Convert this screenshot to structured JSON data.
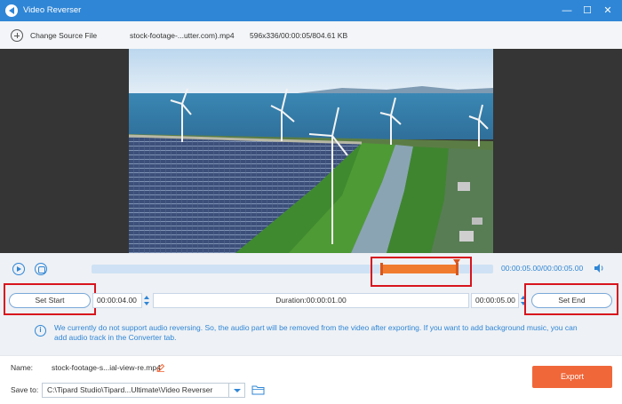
{
  "window": {
    "title": "Video Reverser",
    "minimize_glyph": "—",
    "maximize_glyph": "☐",
    "close_glyph": "✕"
  },
  "infobar": {
    "change_source_label": "Change Source File",
    "filename": "stock-footage-...utter.com).mp4",
    "file_info": "596x336/00:00:05/804.61 KB"
  },
  "player": {
    "current_time": "00:00:05.00",
    "total_time": "/00:00:05.00",
    "trim_start_fraction": 0.72,
    "trim_end_fraction": 0.91
  },
  "trim": {
    "set_start_label": "Set Start",
    "start_value": "00:00:04.00",
    "duration_text": "Duration:00:00:01.00",
    "end_value": "00:00:05.00",
    "set_end_label": "Set End"
  },
  "notice": {
    "icon": "info-icon",
    "text": "We currently do not support audio reversing. So, the audio part will be removed from the video after exporting. If you want to add background music, you can add audio track in the Converter tab."
  },
  "output": {
    "name_label": "Name:",
    "name_value": "stock-footage-s...ial-view-re.mp4",
    "save_to_label": "Save to:",
    "save_to_value": "C:\\Tipard Studio\\Tipard...Ultimate\\Video Reverser",
    "export_label": "Export"
  },
  "colors": {
    "accent": "#2f86d6",
    "export": "#f0673a",
    "trim": "#f07b2e",
    "highlight": "#d8141d"
  }
}
